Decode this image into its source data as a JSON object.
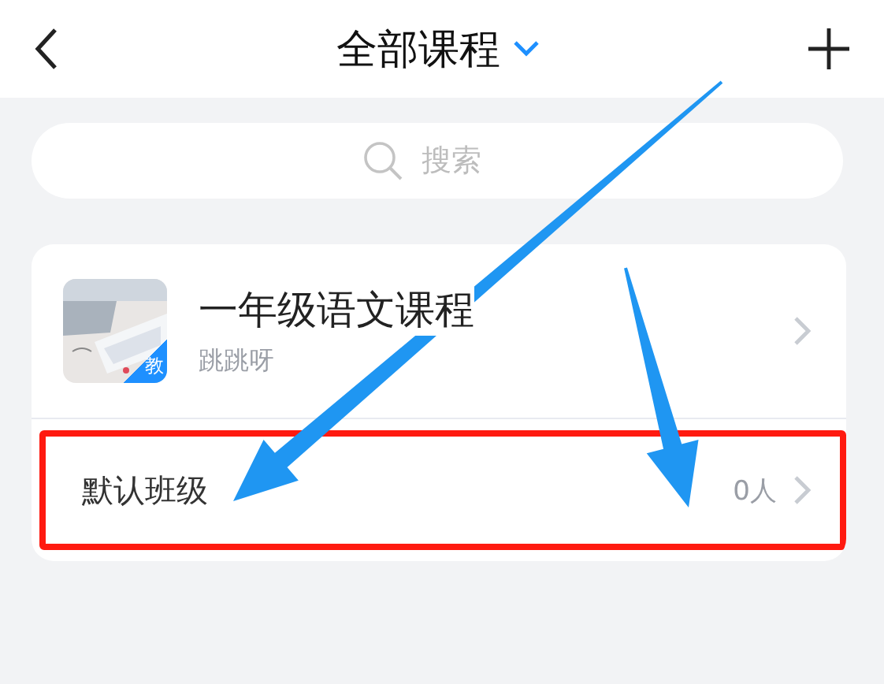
{
  "header": {
    "title": "全部课程"
  },
  "search": {
    "placeholder": "搜索"
  },
  "course": {
    "title": "一年级语文课程",
    "teacher": "跳跳呀",
    "badge": "教"
  },
  "class_row": {
    "name": "默认班级",
    "count": "0人",
    "highlighted": true
  },
  "annotations": {
    "arrows": [
      {
        "kind": "arrow"
      },
      {
        "kind": "arrow"
      }
    ]
  }
}
